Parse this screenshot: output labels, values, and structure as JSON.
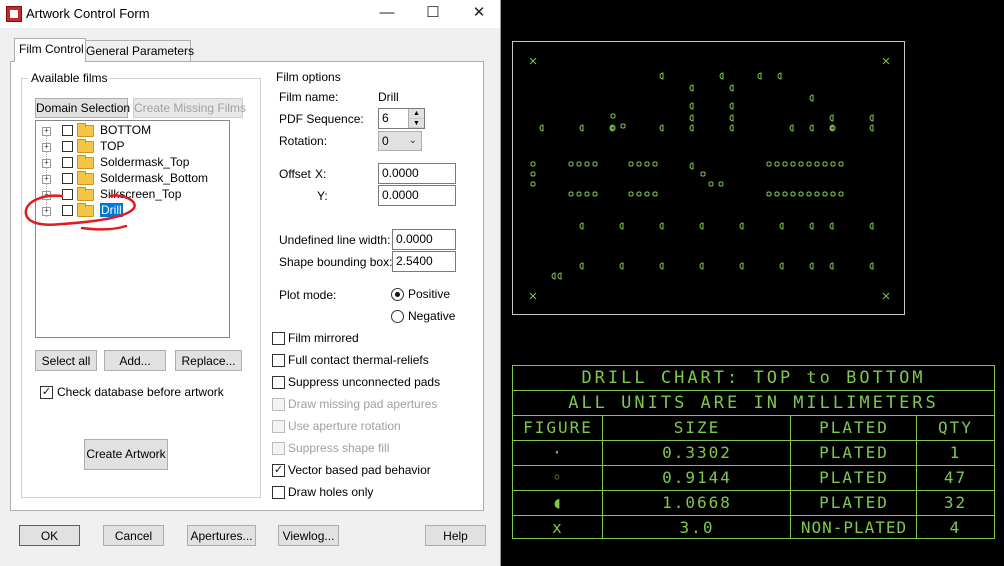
{
  "window": {
    "title": "Artwork Control Form",
    "minimize": "—",
    "maximize": "☐",
    "close": "✕"
  },
  "tabs": [
    {
      "label": "Film Control",
      "active": true
    },
    {
      "label": "General Parameters",
      "active": false
    }
  ],
  "available_films": {
    "group_label": "Available films",
    "domain_selection": "Domain Selection",
    "create_missing_films": "Create Missing Films",
    "films": [
      "BOTTOM",
      "TOP",
      "Soldermask_Top",
      "Soldermask_Bottom",
      "Silkscreen_Top",
      "Drill"
    ],
    "selected": "Drill",
    "select_all": "Select all",
    "add": "Add...",
    "replace": "Replace...",
    "check_database_label": "Check database before artwork",
    "check_database_checked": true,
    "create_artwork": "Create Artwork"
  },
  "film_options": {
    "group_label": "Film options",
    "film_name_label": "Film name:",
    "film_name_value": "Drill",
    "pdf_sequence_label": "PDF Sequence:",
    "pdf_sequence_value": "6",
    "rotation_label": "Rotation:",
    "rotation_value": "0",
    "offset_label": "Offset",
    "offset_x_label": "X:",
    "offset_x_value": "0.0000",
    "offset_y_label": "Y:",
    "offset_y_value": "0.0000",
    "undefined_line_width_label": "Undefined line width:",
    "undefined_line_width_value": "0.0000",
    "shape_bounding_box_label": "Shape bounding box:",
    "shape_bounding_box_value": "2.5400",
    "plot_mode_label": "Plot mode:",
    "positive_label": "Positive",
    "negative_label": "Negative",
    "plot_mode_selected": "Positive",
    "checkboxes": [
      {
        "label": "Film mirrored",
        "checked": false,
        "enabled": true
      },
      {
        "label": "Full contact thermal-reliefs",
        "checked": false,
        "enabled": true
      },
      {
        "label": "Suppress unconnected pads",
        "checked": false,
        "enabled": true
      },
      {
        "label": "Draw missing pad apertures",
        "checked": false,
        "enabled": false
      },
      {
        "label": "Use aperture rotation",
        "checked": false,
        "enabled": false
      },
      {
        "label": "Suppress shape fill",
        "checked": false,
        "enabled": false
      },
      {
        "label": "Vector based pad behavior",
        "checked": true,
        "enabled": true
      },
      {
        "label": "Draw holes only",
        "checked": false,
        "enabled": true
      }
    ]
  },
  "footer": {
    "ok": "OK",
    "cancel": "Cancel",
    "apertures": "Apertures...",
    "viewlog": "Viewlog...",
    "help": "Help"
  },
  "drill_chart": {
    "title": "DRILL CHART: TOP to BOTTOM",
    "units": "ALL UNITS ARE IN MILLIMETERS",
    "headers": [
      "FIGURE",
      "SIZE",
      "PLATED",
      "QTY"
    ],
    "rows": [
      {
        "figure": "·",
        "size": "0.3302",
        "plated": "PLATED",
        "qty": "1"
      },
      {
        "figure": "◦",
        "size": "0.9144",
        "plated": "PLATED",
        "qty": "47"
      },
      {
        "figure": "◖",
        "size": "1.0668",
        "plated": "PLATED",
        "qty": "32"
      },
      {
        "figure": "x",
        "size": "3.0",
        "plated": "NON-PLATED",
        "qty": "4"
      }
    ]
  },
  "colors": {
    "canvas_background": "#000000",
    "drill_green": "#7ec84f",
    "board_outline": "#c8c8c8",
    "annotation_red": "#e31b1b",
    "selection_blue": "#0078d7"
  }
}
